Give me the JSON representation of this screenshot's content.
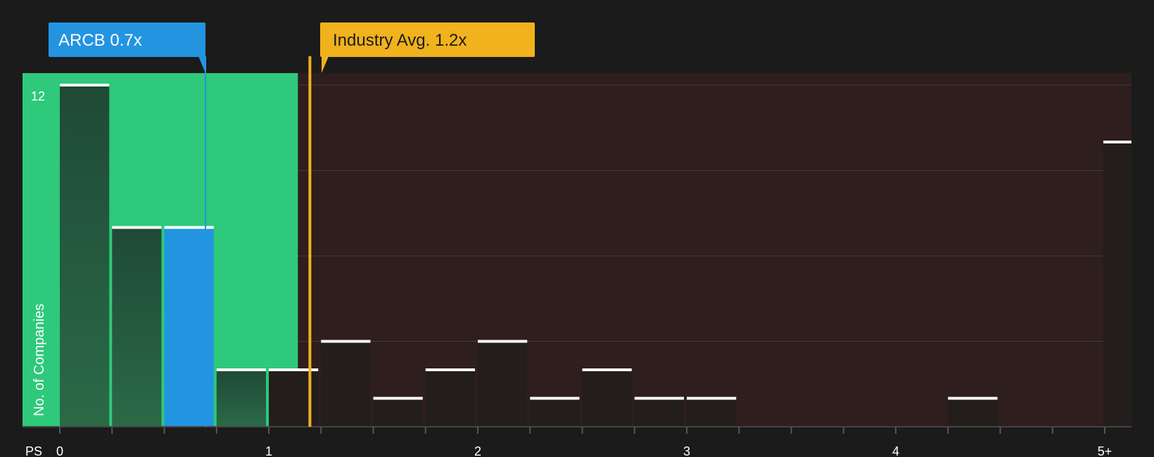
{
  "chart_data": {
    "type": "bar",
    "title": "",
    "xlabel": "PS",
    "ylabel": "No. of Companies",
    "x_ticks": [
      "0",
      "1",
      "2",
      "3",
      "4",
      "5+"
    ],
    "y_ticks": [
      "12"
    ],
    "ylim": [
      0,
      12
    ],
    "bin_width": 0.25,
    "bins": [
      {
        "x": 0.0,
        "value": 12
      },
      {
        "x": 0.25,
        "value": 7
      },
      {
        "x": 0.5,
        "value": 7,
        "highlight": true
      },
      {
        "x": 0.75,
        "value": 2
      },
      {
        "x": 1.0,
        "value": 2
      },
      {
        "x": 1.25,
        "value": 3
      },
      {
        "x": 1.5,
        "value": 1
      },
      {
        "x": 1.75,
        "value": 2
      },
      {
        "x": 2.0,
        "value": 3
      },
      {
        "x": 2.25,
        "value": 1
      },
      {
        "x": 2.5,
        "value": 2
      },
      {
        "x": 2.75,
        "value": 1
      },
      {
        "x": 3.0,
        "value": 1
      },
      {
        "x": 4.25,
        "value": 1
      },
      {
        "x": 5.0,
        "value": 10,
        "label": "5+"
      }
    ],
    "markers": [
      {
        "name": "ARCB",
        "value": 0.7,
        "label": "ARCB 0.7x",
        "color": "#2394e0"
      },
      {
        "name": "Industry Avg.",
        "value": 1.2,
        "label": "Industry Avg. 1.2x",
        "color": "#f0b21d"
      }
    ],
    "colors": {
      "background": "#1b1b1b",
      "undervalued_zone": "#2ec97b",
      "overvalued_zone": "#2e1e1e",
      "bar_in_zone": "#24523a",
      "bar_out_zone": "#231d1c",
      "highlight_bar": "#2394e0",
      "bar_cap": "#ffffff"
    },
    "legend": "none",
    "grid": true
  }
}
